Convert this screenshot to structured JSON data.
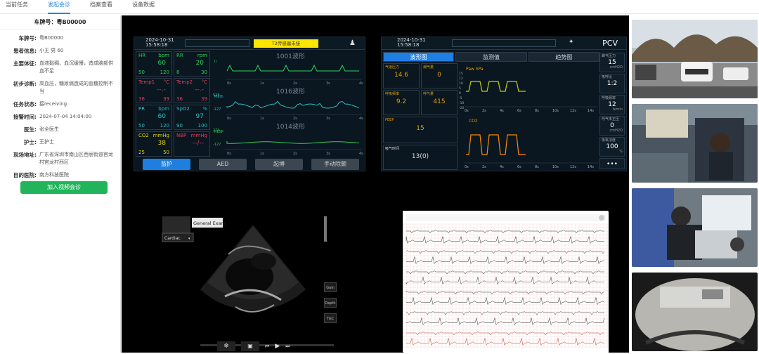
{
  "tabs": [
    "当前任务",
    "发起会诊",
    "档案查看",
    "设备数据"
  ],
  "active_tab": 1,
  "vehicle_header": "车牌号：粤B00000",
  "info": [
    {
      "label": "车牌号:",
      "value": "粤B00000"
    },
    {
      "label": "患者信息:",
      "value": "小王 男 60"
    },
    {
      "label": "主要体征:",
      "value": "血液黏稠、血沉缓慢，造成脑部供血不足"
    },
    {
      "label": "初步诊断:",
      "value": "高血压，糖尿病造成的血糖控制不当"
    },
    {
      "label": "任务状态:",
      "value": "接receiving"
    },
    {
      "label": "接警时间:",
      "value": "2024-07-04 14:04:00"
    },
    {
      "label": "医生:",
      "value": "张全医生"
    },
    {
      "label": "护士:",
      "value": "王护士"
    },
    {
      "label": "现场地址:",
      "value": "广东省深圳市南山区西丽街道官龙村官龙村西区"
    },
    {
      "label": "目的医院:",
      "value": "南方科技医院"
    }
  ],
  "join_button": "加入视频会诊",
  "monitor": {
    "date": "2024-10-31",
    "time": "15:58:18",
    "alarm": "T2传感器未接",
    "vitals": [
      {
        "name": "HR",
        "unit": "bpm",
        "value": "60",
        "lo": "50",
        "hi": "120",
        "color": "#2ed15a"
      },
      {
        "name": "RR",
        "unit": "rpm",
        "value": "20",
        "lo": "8",
        "hi": "30",
        "color": "#2ed15a"
      },
      {
        "name": "Temp1",
        "unit": "°C",
        "value": "--.-",
        "lo": "36",
        "hi": "39",
        "color": "#e0405a"
      },
      {
        "name": "Temp2",
        "unit": "°C",
        "value": "--.-",
        "lo": "36",
        "hi": "39",
        "color": "#e0405a"
      },
      {
        "name": "PR",
        "unit": "bpm",
        "value": "60",
        "lo": "50",
        "hi": "120",
        "color": "#2fc0c0"
      },
      {
        "name": "SpO2",
        "unit": "%",
        "value": "97",
        "lo": "90",
        "hi": "100",
        "color": "#2fc0c0"
      },
      {
        "name": "CO2",
        "unit": "mmHg",
        "value": "38",
        "lo": "25",
        "hi": "50",
        "color": "#e5d200"
      },
      {
        "name": "NBP",
        "unit": "mmHg",
        "value": "--/--",
        "lo": "",
        "hi": "",
        "color": "#e0405a"
      }
    ],
    "waves": [
      "1001波形",
      "1016波形",
      "1014波形"
    ],
    "wave_labels": [
      "II",
      "Pleth",
      "RESP"
    ],
    "wave_scale_hi": [
      "528",
      "273"
    ],
    "wave_scale_lo": [
      "-127",
      "-127"
    ],
    "x_ticks": [
      "0s",
      "1s",
      "2s",
      "3s",
      "4s"
    ],
    "buttons": [
      "监护",
      "AED",
      "起搏",
      "手动除颤"
    ]
  },
  "ventilator": {
    "date": "2024-10-31",
    "time": "15:58:18",
    "mode": "PCV",
    "tabs": [
      "波形图",
      "监测值",
      "趋势图"
    ],
    "params": [
      {
        "label": "气道压力",
        "value": "14.6"
      },
      {
        "label": "潮气量",
        "value": "0"
      },
      {
        "label": "呼吸频率",
        "value": "9.2"
      },
      {
        "label": "呼气量",
        "value": "415"
      },
      {
        "label": "PEEP",
        "value": "15"
      },
      {
        "label": "吸气时间",
        "value": "13(0)"
      }
    ],
    "side": [
      {
        "label": "峰气压力",
        "value": "15",
        "unit": "cmH2O"
      },
      {
        "label": "吸呼比",
        "value": "1:2",
        "unit": ""
      },
      {
        "label": "呼吸频率",
        "value": "12",
        "unit": "b/min"
      },
      {
        "label": "呼气末正压",
        "value": "0",
        "unit": "cmH2O"
      },
      {
        "label": "吸氧浓度",
        "value": "100",
        "unit": "%"
      }
    ],
    "more": "•••",
    "paw_label": "Paw hPa",
    "co2_label": "CO2",
    "paw_y": [
      "15",
      "12",
      "10",
      "5",
      "0",
      "-5",
      "-10",
      "-20"
    ],
    "x_ticks": [
      "0s",
      "2s",
      "4s",
      "6s",
      "8s",
      "10s",
      "12s",
      "14s"
    ]
  },
  "echo": {
    "preset": "General Exam",
    "mode": "Cardiac",
    "side_buttons": [
      "Gain",
      "Depth",
      "TGC"
    ]
  }
}
